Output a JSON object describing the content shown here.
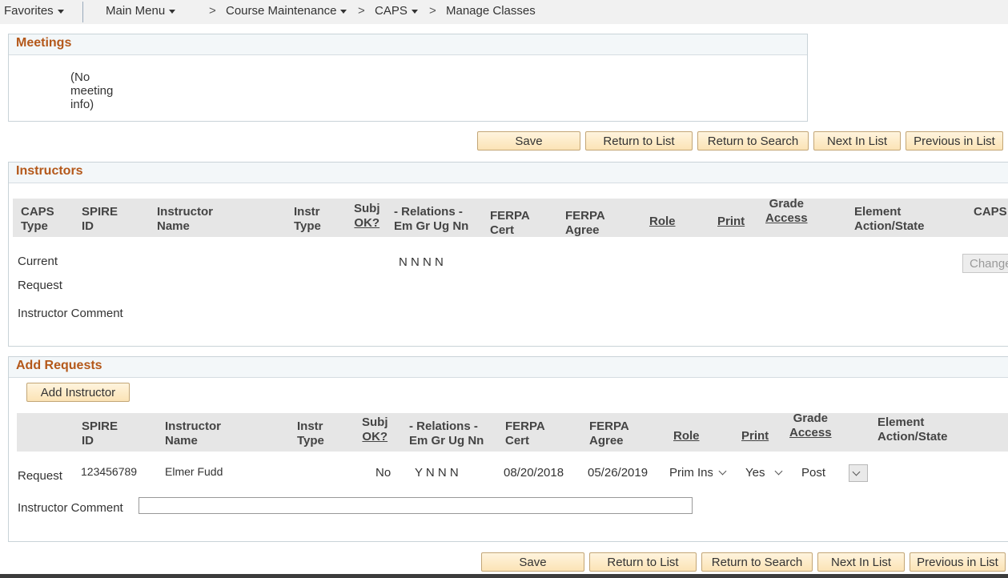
{
  "nav": {
    "favorites": "Favorites",
    "main_menu": "Main Menu",
    "sep": ">",
    "course_maintenance": "Course Maintenance",
    "caps": "CAPS",
    "current": "Manage Classes"
  },
  "meetings": {
    "title": "Meetings",
    "line1": "(No",
    "line2": "meeting",
    "line3": "info)"
  },
  "buttons": {
    "save": "Save",
    "return_to_list": "Return to List",
    "return_to_search": "Return to Search",
    "next_in_list": "Next In List",
    "previous_in_list": "Previous in List",
    "change": "Change",
    "add_instructor": "Add Instructor"
  },
  "instructors": {
    "title": "Instructors",
    "headers": {
      "caps_type_1": "CAPS",
      "caps_type_2": "Type",
      "spire_id_1": "SPIRE",
      "spire_id_2": "ID",
      "instr_name_1": "Instructor",
      "instr_name_2": "Name",
      "instr_type_1": "Instr",
      "instr_type_2": "Type",
      "subj_ok_1": "Subj",
      "subj_ok_2": "OK?",
      "relations_1": "- Relations -",
      "relations_2": "Em Gr Ug Nn",
      "ferpa_cert_1": "FERPA",
      "ferpa_cert_2": "Cert",
      "ferpa_agree_1": "FERPA",
      "ferpa_agree_2": "Agree",
      "role": "Role",
      "print": "Print",
      "grade_access_1": "Grade",
      "grade_access_2": "Access",
      "element_1": "Element",
      "element_2": "Action/State",
      "caps": "CAPS"
    },
    "rows": {
      "current_label": "Current",
      "current_relations": "N  N  N  N",
      "request_label": "Request",
      "comment_label": "Instructor Comment"
    }
  },
  "add_requests": {
    "title": "Add Requests",
    "headers": {
      "spire_id_1": "SPIRE",
      "spire_id_2": "ID",
      "instr_name_1": "Instructor",
      "instr_name_2": "Name",
      "instr_type_1": "Instr",
      "instr_type_2": "Type",
      "subj_ok_1": "Subj",
      "subj_ok_2": "OK?",
      "relations_1": "- Relations -",
      "relations_2": "Em Gr Ug Nn",
      "ferpa_cert_1": "FERPA",
      "ferpa_cert_2": "Cert",
      "ferpa_agree_1": "FERPA",
      "ferpa_agree_2": "Agree",
      "role": "Role",
      "print": "Print",
      "grade_access_1": "Grade",
      "grade_access_2": "Access",
      "element_1": "Element",
      "element_2": "Action/State"
    },
    "row": {
      "label": "Request",
      "spire_id": "123456789",
      "name": "Elmer Fudd",
      "subj_ok": "No",
      "relations": "Y  N  N  N",
      "ferpa_cert": "08/20/2018",
      "ferpa_agree": "05/26/2019",
      "role": "Prim Ins",
      "print": "Yes",
      "grade_access": "Post"
    },
    "comment_label": "Instructor Comment",
    "comment_value": ""
  }
}
